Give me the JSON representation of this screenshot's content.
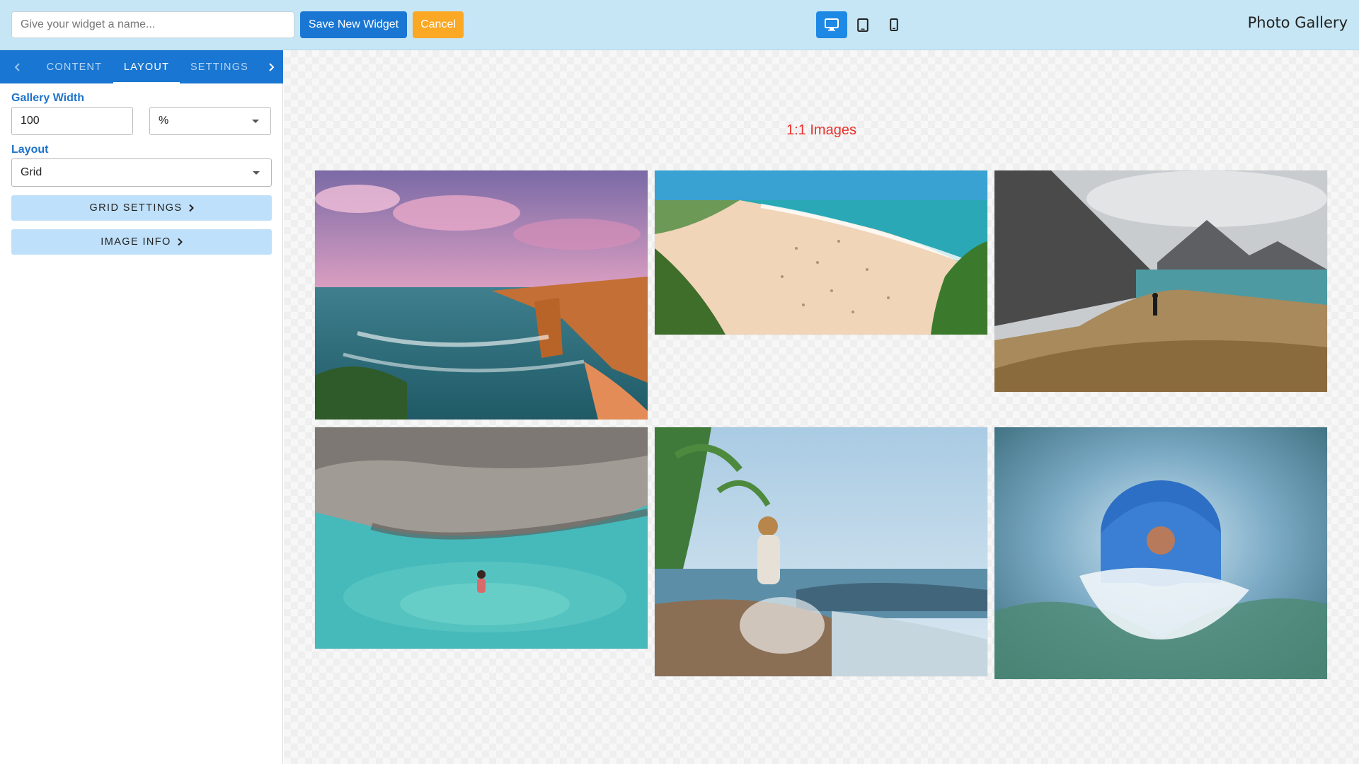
{
  "app": {
    "title": "Photo Gallery"
  },
  "toolbar": {
    "name_placeholder": "Give your widget a name...",
    "name_value": "",
    "save_label": "Save New Widget",
    "cancel_label": "Cancel",
    "devices": [
      {
        "name": "desktop",
        "icon": "desktop-icon",
        "active": true
      },
      {
        "name": "tablet",
        "icon": "tablet-icon",
        "active": false
      },
      {
        "name": "mobile",
        "icon": "mobile-icon",
        "active": false
      }
    ]
  },
  "sidebar": {
    "tabs": [
      {
        "label": "Content",
        "active": false
      },
      {
        "label": "Layout",
        "active": true
      },
      {
        "label": "Settings",
        "active": false
      }
    ],
    "gallery_width": {
      "label": "Gallery Width",
      "value": "100",
      "unit": "%"
    },
    "layout": {
      "label": "Layout",
      "value": "Grid"
    },
    "buttons": {
      "grid_settings": "Grid Settings",
      "image_info": "Image Info"
    }
  },
  "gallery": {
    "title": "1:1 Images",
    "images": [
      {
        "name": "coastal-cliffs-sunset"
      },
      {
        "name": "crowded-beach-aerial"
      },
      {
        "name": "mountain-fjord-hiker"
      },
      {
        "name": "rock-cliff-lagoon-swimmer"
      },
      {
        "name": "tropical-beach-splash"
      },
      {
        "name": "wave-barrel-surfer"
      }
    ]
  },
  "colors": {
    "topbar": "#c6e6f5",
    "primary": "#1976d2",
    "cancel": "#fba824",
    "label": "#1e73c9",
    "section_button": "#bfe0fa",
    "gallery_title": "#e8322a"
  }
}
